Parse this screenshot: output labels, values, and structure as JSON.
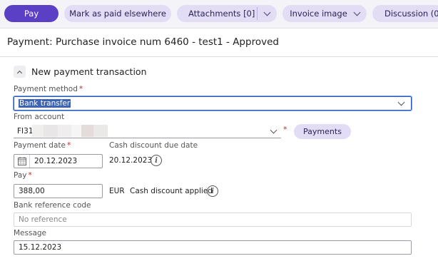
{
  "toolbar": {
    "pay": "Pay",
    "mark_paid": "Mark as paid elsewhere",
    "attachments": "Attachments [0]",
    "invoice_image": "Invoice image",
    "discussion": "Discussion (0"
  },
  "page_title": "Payment: Purchase invoice num 6460 - test1 - Approved",
  "section": {
    "title": "New payment transaction"
  },
  "payment_method": {
    "label": "Payment method",
    "value": "Bank transfer"
  },
  "from_account": {
    "label": "From account",
    "value": "FI31",
    "payments_button": "Payments"
  },
  "payment_date": {
    "label": "Payment date",
    "value": "20.12.2023"
  },
  "cash_discount_due": {
    "label": "Cash discount due date",
    "value": "20.12.2023"
  },
  "pay": {
    "label": "Pay",
    "value": "388,00",
    "currency": "EUR",
    "discount_text": "Cash discount applied"
  },
  "bank_reference": {
    "label": "Bank reference code",
    "placeholder": "No reference"
  },
  "message": {
    "label": "Message",
    "value": "15.12.2023"
  },
  "required_mark": "*",
  "info_glyph": "i",
  "colors": {
    "primary": "#5b3fc4",
    "pill": "#e2dcf5",
    "required": "#c62828",
    "selection": "#3d64b6"
  }
}
